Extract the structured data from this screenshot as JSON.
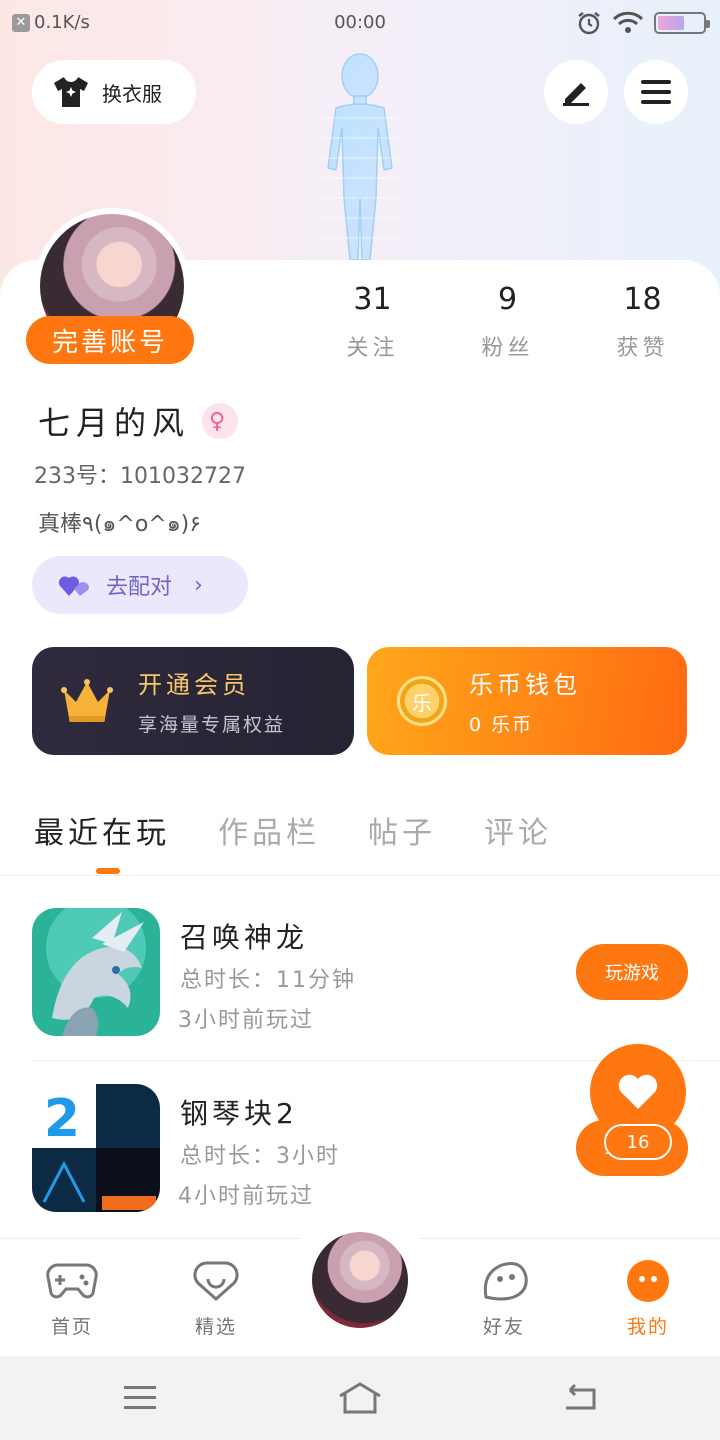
{
  "status_bar": {
    "net_speed": "0.1K/s",
    "time": "00:00"
  },
  "header": {
    "outfit_label": "换衣服"
  },
  "profile": {
    "complete_label": "完善账号",
    "stats": [
      {
        "num": "31",
        "label": "关注"
      },
      {
        "num": "9",
        "label": "粉丝"
      },
      {
        "num": "18",
        "label": "获赞"
      }
    ],
    "name": "七月的风",
    "gender_symbol": "♀",
    "uid": "233号：101032727",
    "bio": "真棒٩(๑^o^๑)۶",
    "match_label": "去配对"
  },
  "cards": {
    "vip_title": "开通会员",
    "vip_sub": "享海量专属权益",
    "wallet_title": "乐币钱包",
    "wallet_sub": "0 乐币",
    "coin_char": "乐"
  },
  "tabs": [
    "最近在玩",
    "作品栏",
    "帖子",
    "评论"
  ],
  "games": [
    {
      "name": "召唤神龙",
      "duration": "总时长：11分钟",
      "last_played": "3小时前玩过",
      "button": "玩游戏"
    },
    {
      "name": "钢琴块2",
      "duration": "总时长：3小时",
      "last_played": "4小时前玩过",
      "button": "玩游戏"
    }
  ],
  "fab": {
    "count": "16"
  },
  "bottom_nav": [
    {
      "label": "首页",
      "icon": "gamepad-icon"
    },
    {
      "label": "精选",
      "icon": "heart-chat-icon"
    },
    {
      "label": "好友",
      "icon": "friend-face-icon"
    },
    {
      "label": "我的",
      "icon": "my-face-icon"
    }
  ],
  "colors": {
    "accent": "#ff7711",
    "vip_dark": "#2f2a3d",
    "match_bg": "#ebe8fb"
  }
}
